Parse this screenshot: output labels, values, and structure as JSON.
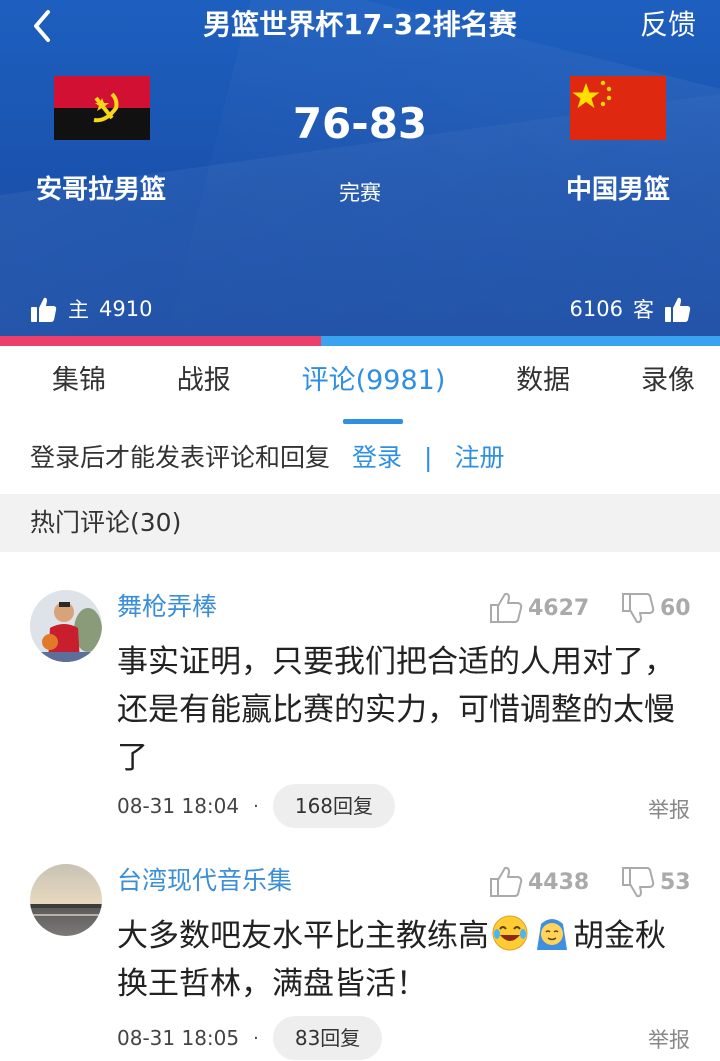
{
  "header": {
    "title": "男篮世界杯17-32排名赛",
    "feedback_label": "反馈",
    "back_icon": "chevron-left-icon"
  },
  "match": {
    "home_team": "安哥拉男篮",
    "away_team": "中国男篮",
    "score": "76-83",
    "status": "完赛",
    "home_vote_label": "主",
    "home_votes": "4910",
    "away_vote_label": "客",
    "away_votes": "6106",
    "home_vote_share": 0.446,
    "home_color": "#ec3f6b",
    "away_color": "#3aa3f0"
  },
  "tabs": [
    {
      "label": "集锦",
      "active": false
    },
    {
      "label": "战报",
      "active": false
    },
    {
      "label": "评论(9981)",
      "active": true
    },
    {
      "label": "数据",
      "active": false
    },
    {
      "label": "录像",
      "active": false
    }
  ],
  "login_prompt": {
    "text": "登录后才能发表评论和回复",
    "login_label": "登录",
    "separator": "|",
    "register_label": "注册"
  },
  "section": {
    "title": "热门评论(30)"
  },
  "comments": [
    {
      "user": "舞枪弄棒",
      "likes": "4627",
      "dislikes": "60",
      "text": "事实证明，只要我们把合适的人用对了，还是有能赢比赛的实力，可惜调整的太慢了",
      "time": "08-31 18:04",
      "dot": "·",
      "replies": "168回复",
      "report": "举报"
    },
    {
      "user": "台湾现代音乐集",
      "likes": "4438",
      "dislikes": "53",
      "text_before": "大多数吧友水平比主教练高",
      "text_after": "胡金秋换王哲林，满盘皆活！",
      "time": "08-31 18:05",
      "dot": "·",
      "replies": "83回复",
      "report": "举报"
    }
  ]
}
